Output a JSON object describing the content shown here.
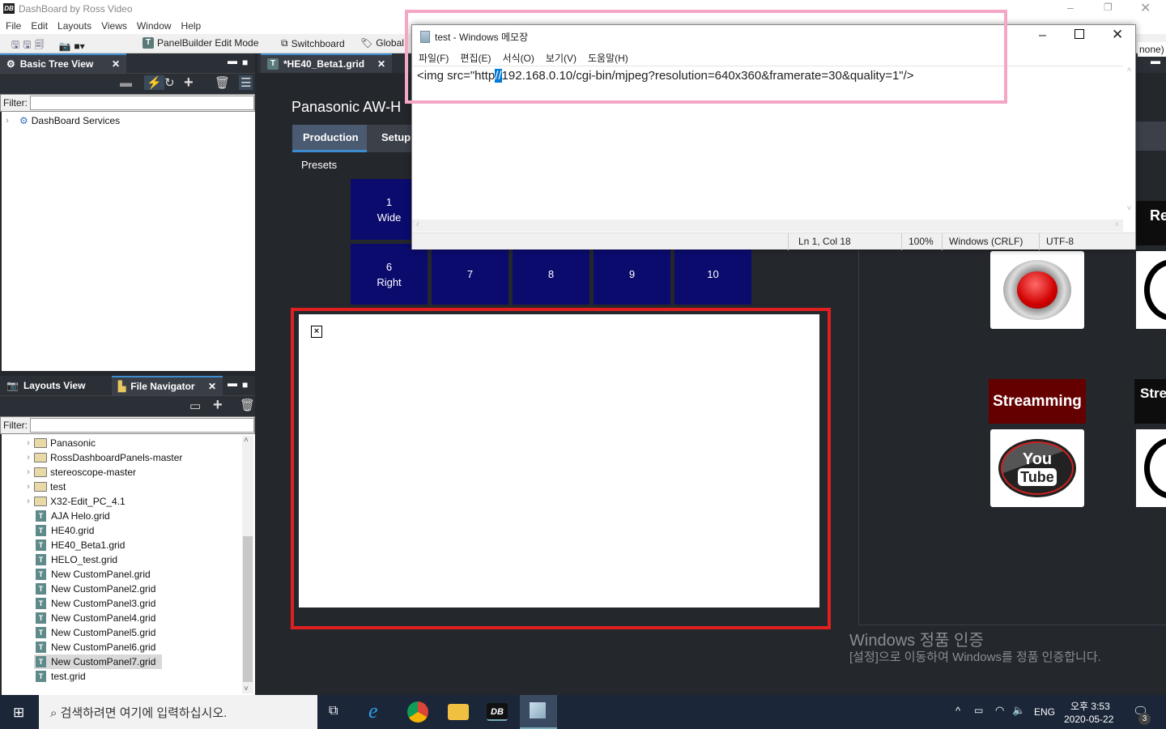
{
  "app": {
    "title": "DashBoard by Ross Video",
    "logo": "DB"
  },
  "menu": [
    "File",
    "Edit",
    "Layouts",
    "Views",
    "Window",
    "Help"
  ],
  "toolbar": {
    "panelbuilder": "PanelBuilder Edit Mode",
    "switchboard": "Switchboard",
    "global": "Global",
    "none_suffix": "none)"
  },
  "tree_pane": {
    "tab": "Basic Tree View",
    "filter_label": "Filter:",
    "filter_value": "",
    "items": [
      "DashBoard Services"
    ]
  },
  "file_pane": {
    "tabs": [
      "Layouts View",
      "File Navigator"
    ],
    "filter_label": "Filter:",
    "filter_value": "",
    "folders": [
      "Panasonic",
      "RossDashboardPanels-master",
      "stereoscope-master",
      "test",
      "X32-Edit_PC_4.1"
    ],
    "files": [
      "AJA Helo.grid",
      "HE40.grid",
      "HE40_Beta1.grid",
      "HELO_test.grid",
      "New CustomPanel.grid",
      "New CustomPanel2.grid",
      "New CustomPanel3.grid",
      "New CustomPanel4.grid",
      "New CustomPanel5.grid",
      "New CustomPanel6.grid",
      "New CustomPanel7.grid",
      "test.grid"
    ],
    "selected": "New CustomPanel7.grid"
  },
  "editor": {
    "tab": "*HE40_Beta1.grid",
    "panel_title": "Panasonic AW-H",
    "tabs": [
      "Production",
      "Setup"
    ],
    "presets_label": "Presets",
    "presets": [
      {
        "num": "1",
        "name": "Wide"
      },
      {
        "num": "6",
        "name": "Right"
      },
      {
        "num": "7",
        "name": ""
      },
      {
        "num": "8",
        "name": ""
      },
      {
        "num": "9",
        "name": ""
      },
      {
        "num": "10",
        "name": ""
      }
    ],
    "broken_image": "⊠",
    "streaming_label": "Streamming",
    "record_partial": "Re",
    "stream_partial": "Stre",
    "youtube_you": "You",
    "youtube_tube": "Tube"
  },
  "notepad": {
    "title": "test - Windows 메모장",
    "menu": [
      "파일(F)",
      "편집(E)",
      "서식(O)",
      "보기(V)",
      "도움말(H)"
    ],
    "text_before": "<img src=\"http",
    "text_selected": "//",
    "text_after": "192.168.0.10/cgi-bin/mjpeg?resolution=640x360&framerate=30&quality=1\"/>",
    "status": {
      "position": "Ln 1, Col 18",
      "zoom": "100%",
      "eol": "Windows (CRLF)",
      "encoding": "UTF-8"
    }
  },
  "watermark": {
    "line1": "Windows 정품 인증",
    "line2": "[설정]으로 이동하여 Windows를 정품 인증합니다."
  },
  "taskbar": {
    "search_placeholder": "검색하려면 여기에 입력하십시오.",
    "lang": "ENG",
    "time": "오후 3:53",
    "date": "2020-05-22",
    "notifications": "3"
  },
  "colors": {
    "preset": "#0b0b6e",
    "annotation_pink": "#f4a6c6",
    "annotation_red": "#e02020",
    "streaming": "#640000",
    "selection": "#0078d7"
  }
}
